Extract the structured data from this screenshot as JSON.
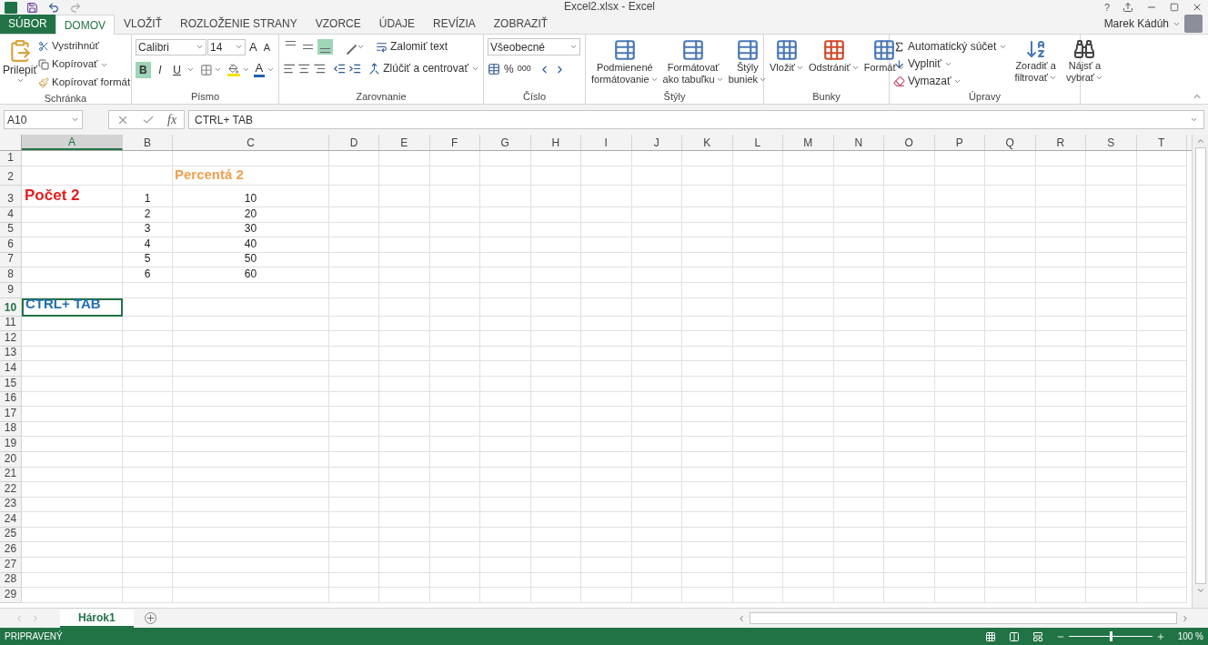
{
  "window": {
    "title": "Excel2.xlsx - Excel",
    "user": "Marek Kádúh",
    "help": "?"
  },
  "tabs": [
    {
      "label": "SÚBOR",
      "kind": "file",
      "selected": false
    },
    {
      "label": "DOMOV",
      "kind": "tab",
      "selected": true
    },
    {
      "label": "VLOŽIŤ",
      "kind": "tab",
      "selected": false
    },
    {
      "label": "ROZLOŽENIE STRANY",
      "kind": "tab",
      "selected": false
    },
    {
      "label": "VZORCE",
      "kind": "tab",
      "selected": false
    },
    {
      "label": "ÚDAJE",
      "kind": "tab",
      "selected": false
    },
    {
      "label": "REVÍZIA",
      "kind": "tab",
      "selected": false
    },
    {
      "label": "ZOBRAZIŤ",
      "kind": "tab",
      "selected": false
    }
  ],
  "ribbon": {
    "clipboard": {
      "label": "Schránka",
      "paste": "Prilepiť",
      "items": [
        "Vystrihnúť",
        "Kopírovať",
        "Kopírovať formát"
      ]
    },
    "font": {
      "label": "Písmo",
      "name": "Calibri",
      "size": "14",
      "grow": "A",
      "shrink": "A",
      "color_letter": "A",
      "styles": [
        {
          "label": "B",
          "selected": true
        },
        {
          "label": "I",
          "selected": false
        },
        {
          "label": "U",
          "selected": false
        }
      ]
    },
    "alignment": {
      "label": "Zarovnanie",
      "vertical": [
        {
          "selected": false
        },
        {
          "selected": false
        },
        {
          "selected": true
        }
      ],
      "wrap": "Zalomiť text",
      "merge": "Zlúčiť a centrovať"
    },
    "number": {
      "label": "Číslo",
      "format": "Všeobecné",
      "percent": "%",
      "thousands": "000"
    },
    "styles": {
      "label": "Štýly",
      "buttons": [
        [
          "Podmienené",
          "formátovanie"
        ],
        [
          "Formátovať",
          "ako tabuľku"
        ],
        [
          "Štýly",
          "buniek"
        ]
      ]
    },
    "cells": {
      "label": "Bunky",
      "buttons": [
        "Vložiť",
        "Odstrániť",
        "Formát"
      ]
    },
    "editing": {
      "label": "Úpravy",
      "items": [
        "Automatický súčet",
        "Vyplniť",
        "Vymazať"
      ],
      "buttons": [
        [
          "Zoradiť a",
          "filtrovať"
        ],
        [
          "Nájsť a",
          "vybrať"
        ]
      ]
    }
  },
  "formula_bar": {
    "name_box": "A10",
    "fx": "fx",
    "value": "CTRL+ TAB"
  },
  "sheet": {
    "columns": [
      {
        "label": "A",
        "selected": true
      },
      {
        "label": "B",
        "selected": false
      },
      {
        "label": "C",
        "selected": false
      },
      {
        "label": "D",
        "selected": false
      },
      {
        "label": "E",
        "selected": false
      },
      {
        "label": "F",
        "selected": false
      },
      {
        "label": "G",
        "selected": false
      },
      {
        "label": "H",
        "selected": false
      },
      {
        "label": "I",
        "selected": false
      },
      {
        "label": "J",
        "selected": false
      },
      {
        "label": "K",
        "selected": false
      },
      {
        "label": "L",
        "selected": false
      },
      {
        "label": "M",
        "selected": false
      },
      {
        "label": "N",
        "selected": false
      },
      {
        "label": "O",
        "selected": false
      },
      {
        "label": "P",
        "selected": false
      },
      {
        "label": "Q",
        "selected": false
      },
      {
        "label": "R",
        "selected": false
      },
      {
        "label": "S",
        "selected": false
      },
      {
        "label": "T",
        "selected": false
      }
    ],
    "rows": [
      {
        "label": "1",
        "selected": false
      },
      {
        "label": "2",
        "selected": false,
        "c": {
          "text": "Percentá 2",
          "kind": "subheading",
          "selected": false
        }
      },
      {
        "label": "3",
        "selected": false,
        "a": {
          "text": "Počet 2",
          "kind": "heading",
          "selected": false
        },
        "b": {
          "text": "1",
          "kind": "number",
          "selected": false
        },
        "c": {
          "text": "10",
          "kind": "number",
          "selected": false
        }
      },
      {
        "label": "4",
        "selected": false,
        "b": {
          "text": "2",
          "kind": "number",
          "selected": false
        },
        "c": {
          "text": "20",
          "kind": "number",
          "selected": false
        }
      },
      {
        "label": "5",
        "selected": false,
        "b": {
          "text": "3",
          "kind": "number",
          "selected": false
        },
        "c": {
          "text": "30",
          "kind": "number",
          "selected": false
        }
      },
      {
        "label": "6",
        "selected": false,
        "b": {
          "text": "4",
          "kind": "number",
          "selected": false
        },
        "c": {
          "text": "40",
          "kind": "number",
          "selected": false
        }
      },
      {
        "label": "7",
        "selected": false,
        "b": {
          "text": "5",
          "kind": "number",
          "selected": false
        },
        "c": {
          "text": "50",
          "kind": "number",
          "selected": false
        }
      },
      {
        "label": "8",
        "selected": false,
        "b": {
          "text": "6",
          "kind": "number",
          "selected": false
        },
        "c": {
          "text": "60",
          "kind": "number",
          "selected": false
        }
      },
      {
        "label": "9",
        "selected": false
      },
      {
        "label": "10",
        "selected": true,
        "a": {
          "text": "CTRL+ TAB",
          "kind": "note",
          "selected": true
        }
      },
      {
        "label": "11",
        "selected": false
      },
      {
        "label": "12",
        "selected": false
      },
      {
        "label": "13",
        "selected": false
      },
      {
        "label": "14",
        "selected": false
      },
      {
        "label": "15",
        "selected": false
      },
      {
        "label": "16",
        "selected": false
      },
      {
        "label": "17",
        "selected": false
      },
      {
        "label": "18",
        "selected": false
      },
      {
        "label": "19",
        "selected": false
      },
      {
        "label": "20",
        "selected": false
      },
      {
        "label": "21",
        "selected": false
      },
      {
        "label": "22",
        "selected": false
      },
      {
        "label": "23",
        "selected": false
      },
      {
        "label": "24",
        "selected": false
      },
      {
        "label": "25",
        "selected": false
      },
      {
        "label": "26",
        "selected": false
      },
      {
        "label": "27",
        "selected": false
      },
      {
        "label": "28",
        "selected": false
      },
      {
        "label": "29",
        "selected": false
      }
    ]
  },
  "sheet_tabs": [
    {
      "label": "Hárok1",
      "selected": true
    }
  ],
  "status_bar": {
    "text": "PRIPRAVENÝ",
    "zoom": "100 %",
    "zoom_level": {
      "level": 0.5
    }
  }
}
